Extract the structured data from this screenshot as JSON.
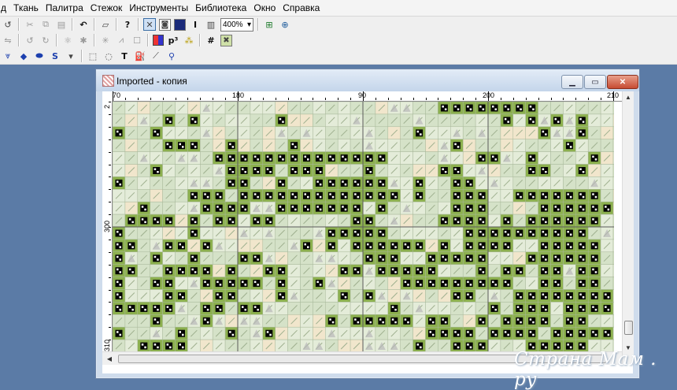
{
  "menu": {
    "items": [
      "д",
      "Ткань",
      "Палитра",
      "Стежок",
      "Инструменты",
      "Библиотека",
      "Окно",
      "Справка"
    ]
  },
  "toolbar": {
    "zoom": "400%",
    "row1_icons": [
      "undo-icon",
      "cut-icon",
      "copy-icon",
      "paste-icon",
      "redo-icon",
      "open-icon",
      "help-icon",
      "select-x-icon",
      "fill-icon",
      "square-icon",
      "text-i-icon",
      "book-icon",
      "zoom-fit-icon",
      "zoom-search-icon"
    ],
    "row2_icons": [
      "mirror-icon",
      "rotate-left-icon",
      "rotate-right-icon",
      "stitch-icon",
      "cross-icon",
      "half-cross-icon",
      "backstitch-icon",
      "box-icon",
      "palette-icon",
      "superscript-icon",
      "grid-pattern-icon",
      "hash-icon",
      "cross-x-icon"
    ],
    "row3_icons": [
      "stitch-down-icon",
      "diamond-icon",
      "ellipse-icon",
      "s-tool-icon",
      "rect-select-icon",
      "lasso-icon",
      "text-t-icon",
      "fill-bucket-icon",
      "eyedropper-icon",
      "magnifier-icon"
    ]
  },
  "window": {
    "title": "Imported - копия",
    "ruler_x": [
      "70",
      "180",
      "90",
      "200",
      "210"
    ],
    "ruler_y": [
      "2",
      "300",
      "310"
    ]
  },
  "pattern": {
    "colors": {
      "light_cell": "#d5e2c8",
      "light_cell_alt": "#e4ecd9",
      "dark_cell": "#8cb04e",
      "dark_symbol": "#000000",
      "grid_line": "#a8b89a",
      "major_line": "#5a5a5a",
      "peach": "#f1e6cc",
      "gray_tri": "#b8b8b8"
    }
  },
  "watermark": "Страна Мам . ру"
}
